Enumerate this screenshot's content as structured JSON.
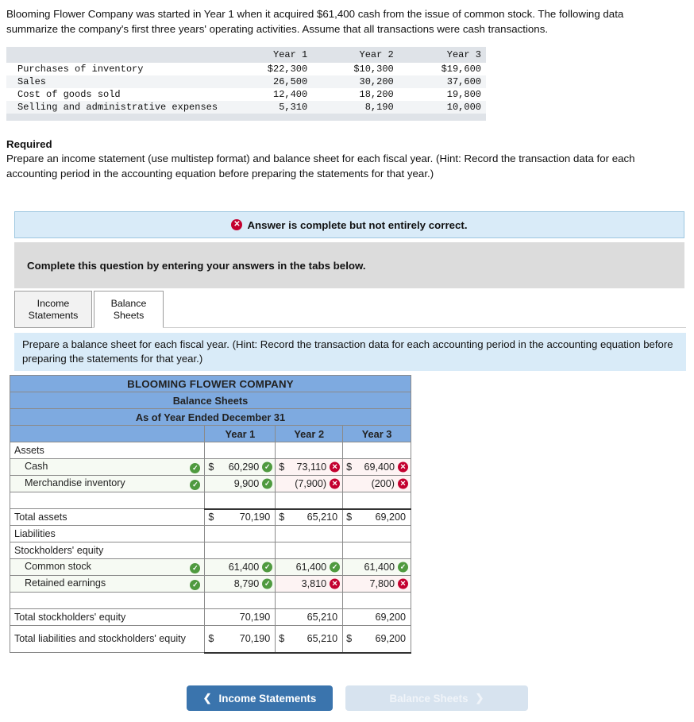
{
  "problem": {
    "paragraph": "Blooming Flower Company was started in Year 1 when it acquired $61,400 cash from the issue of common stock. The following data summarize the company's first three years' operating activities. Assume that all transactions were cash transactions."
  },
  "given_table": {
    "headers": [
      "",
      "Year 1",
      "Year 2",
      "Year 3"
    ],
    "rows": [
      {
        "label": "Purchases of inventory",
        "year1": "$22,300",
        "year2": "$10,300",
        "year3": "$19,600"
      },
      {
        "label": "Sales",
        "year1": "26,500",
        "year2": "30,200",
        "year3": "37,600"
      },
      {
        "label": "Cost of goods sold",
        "year1": "12,400",
        "year2": "18,200",
        "year3": "19,800"
      },
      {
        "label": "Selling and administrative expenses",
        "year1": "5,310",
        "year2": "8,190",
        "year3": "10,000"
      }
    ]
  },
  "required": {
    "heading": "Required",
    "body": "Prepare an income statement (use multistep format) and balance sheet for each fiscal year. (Hint: Record the transaction data for each accounting period in the accounting equation before preparing the statements for that year.)"
  },
  "status_banner": {
    "icon": "x-circle-icon",
    "text": "Answer is complete but not entirely correct."
  },
  "gray_band": {
    "text": "Complete this question by entering your answers in the tabs below."
  },
  "tabs": [
    {
      "id": "income-statements",
      "line1": "Income",
      "line2": "Statements",
      "active": false
    },
    {
      "id": "balance-sheets",
      "line1": "Balance",
      "line2": "Sheets",
      "active": true
    }
  ],
  "sub_instruction": {
    "text": "Prepare a balance sheet for each fiscal year. (Hint: Record the transaction data for each accounting period in the accounting equation before preparing the statements for that year.)"
  },
  "balance_sheet": {
    "title": "BLOOMING FLOWER COMPANY",
    "subtitle": "Balance Sheets",
    "period": "As of Year Ended December 31",
    "column_headers": [
      "Year 1",
      "Year 2",
      "Year 3"
    ],
    "rows": [
      {
        "label": "Assets",
        "type": "section",
        "values": [
          "",
          "",
          ""
        ]
      },
      {
        "label": "Cash",
        "type": "input",
        "indent": true,
        "label_mark": "ok",
        "values": [
          "60,290",
          "73,110",
          "69,400"
        ],
        "dollars": [
          true,
          true,
          true
        ],
        "marks": [
          "ok",
          "bad",
          "bad"
        ]
      },
      {
        "label": "Merchandise inventory",
        "type": "input",
        "indent": true,
        "label_mark": "ok",
        "values": [
          "9,900",
          "(7,900)",
          "(200)"
        ],
        "dollars": [
          false,
          false,
          false
        ],
        "marks": [
          "ok",
          "bad",
          "bad"
        ]
      },
      {
        "label": "",
        "type": "spacer",
        "values": [
          "",
          "",
          ""
        ]
      },
      {
        "label": "Total assets",
        "type": "total",
        "values": [
          "70,190",
          "65,210",
          "69,200"
        ],
        "dollars": [
          true,
          true,
          true
        ]
      },
      {
        "label": "Liabilities",
        "type": "section",
        "values": [
          "",
          "",
          ""
        ]
      },
      {
        "label": "Stockholders' equity",
        "type": "section",
        "values": [
          "",
          "",
          ""
        ]
      },
      {
        "label": "Common stock",
        "type": "input",
        "indent": true,
        "label_mark": "ok",
        "values": [
          "61,400",
          "61,400",
          "61,400"
        ],
        "dollars": [
          false,
          false,
          false
        ],
        "marks": [
          "ok",
          "ok",
          "ok"
        ]
      },
      {
        "label": "Retained earnings",
        "type": "input",
        "indent": true,
        "label_mark": "ok",
        "values": [
          "8,790",
          "3,810",
          "7,800"
        ],
        "dollars": [
          false,
          false,
          false
        ],
        "marks": [
          "ok",
          "bad",
          "bad"
        ]
      },
      {
        "label": "",
        "type": "spacer",
        "values": [
          "",
          "",
          ""
        ]
      },
      {
        "label": "Total stockholders' equity",
        "type": "total-plain",
        "values": [
          "70,190",
          "65,210",
          "69,200"
        ],
        "dollars": [
          false,
          false,
          false
        ]
      },
      {
        "label": "Total liabilities and stockholders' equity",
        "type": "grand-total",
        "values": [
          "70,190",
          "65,210",
          "69,200"
        ],
        "dollars": [
          true,
          true,
          true
        ]
      }
    ]
  },
  "nav": {
    "prev_label": "Income Statements",
    "prev_icon": "chevron-left-icon",
    "next_label": "Balance Sheets",
    "next_icon": "chevron-right-icon"
  },
  "colors": {
    "header_blue": "#7eaae0",
    "banner_blue": "#d9ebf8",
    "band_gray": "#dcdcdc",
    "ok_green": "#4f9a3f",
    "bad_red": "#c3002f",
    "primary_button": "#3a74ad",
    "disabled_button": "#d7e3ef"
  }
}
